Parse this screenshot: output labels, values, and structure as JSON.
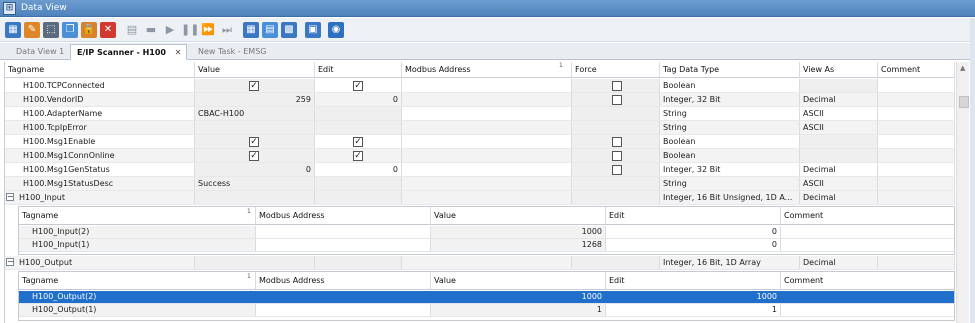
{
  "window": {
    "title": "Data View",
    "app_icon_glyph": "⊞"
  },
  "toolbar": {
    "buttons": [
      {
        "name": "data-view-icon",
        "glyph": "▦",
        "color": "#3b78c4"
      },
      {
        "name": "add-tags-icon",
        "glyph": "✎",
        "color": "#e0862a"
      },
      {
        "name": "select-icon",
        "glyph": "⬚",
        "color": "#5a6b7e"
      },
      {
        "name": "copy-icon",
        "glyph": "❐",
        "color": "#4a8fd8"
      },
      {
        "name": "lock-icon",
        "glyph": "🔒",
        "color": "#d9822b"
      },
      {
        "name": "delete-icon",
        "glyph": "✕",
        "color": "#d23a2f"
      },
      {
        "name": "page-icon",
        "glyph": "▤",
        "color": "grey"
      },
      {
        "name": "save-icon",
        "glyph": "▬",
        "color": "grey"
      },
      {
        "name": "play-icon",
        "glyph": "▶",
        "color": "grey"
      },
      {
        "name": "pause-icon",
        "glyph": "❚❚",
        "color": "grey"
      },
      {
        "name": "step-forward-icon",
        "glyph": "⏩",
        "color": "grey"
      },
      {
        "name": "step-end-icon",
        "glyph": "⏭",
        "color": "grey"
      },
      {
        "name": "grid-view-icon",
        "glyph": "▦",
        "color": "#3b78c4"
      },
      {
        "name": "table-icon",
        "glyph": "▤",
        "color": "#4a8fd8"
      },
      {
        "name": "spreadsheet-icon",
        "glyph": "▩",
        "color": "#3b78c4"
      },
      {
        "name": "properties-icon",
        "glyph": "▣",
        "color": "#3b78c4"
      },
      {
        "name": "help-icon",
        "glyph": "◉",
        "color": "#2d6fc1"
      }
    ]
  },
  "tabs": [
    {
      "label": "Data View 1",
      "active": false
    },
    {
      "label": "E/IP Scanner - H100",
      "active": true,
      "close": "✕"
    },
    {
      "label": "New Task - EMSG",
      "active": false
    }
  ],
  "grid": {
    "columns": [
      "Tagname",
      "Value",
      "Edit",
      "Modbus Address",
      "Force",
      "Tag Data Type",
      "View As",
      "Comment"
    ],
    "sort_indicator": "1",
    "rows": [
      {
        "tagname": "H100.TCPConnected",
        "value": "",
        "value_check": true,
        "edit": "",
        "edit_check": true,
        "force_check": false,
        "type": "Boolean",
        "view_as": ""
      },
      {
        "tagname": "H100.VendorID",
        "value": "259",
        "value_check": null,
        "edit": "0",
        "edit_check": null,
        "force_check": false,
        "type": "Integer, 32 Bit",
        "view_as": "Decimal"
      },
      {
        "tagname": "H100.AdapterName",
        "value": "CBAC-H100",
        "value_check": null,
        "edit": "",
        "edit_check": null,
        "force_check": null,
        "type": "String",
        "view_as": "ASCII"
      },
      {
        "tagname": "H100.TcpIpError",
        "value": "",
        "value_check": null,
        "edit": "",
        "edit_check": null,
        "force_check": null,
        "type": "String",
        "view_as": "ASCII"
      },
      {
        "tagname": "H100.Msg1Enable",
        "value": "",
        "value_check": true,
        "edit": "",
        "edit_check": true,
        "force_check": false,
        "type": "Boolean",
        "view_as": ""
      },
      {
        "tagname": "H100.Msg1ConnOnline",
        "value": "",
        "value_check": true,
        "edit": "",
        "edit_check": true,
        "force_check": false,
        "type": "Boolean",
        "view_as": ""
      },
      {
        "tagname": "H100.Msg1GenStatus",
        "value": "0",
        "value_check": null,
        "edit": "0",
        "edit_check": null,
        "force_check": false,
        "type": "Integer, 32 Bit",
        "view_as": "Decimal"
      },
      {
        "tagname": "H100.Msg1StatusDesc",
        "value": "Success",
        "value_check": null,
        "edit": "",
        "edit_check": null,
        "force_check": null,
        "type": "String",
        "view_as": "ASCII"
      }
    ],
    "input_group": {
      "tagname": "H100_Input",
      "type": "Integer, 16 Bit Unsigned, 1D A...",
      "view_as": "Decimal",
      "sub_columns": [
        "Tagname",
        "Modbus Address",
        "Value",
        "Edit",
        "Comment"
      ],
      "rows": [
        {
          "tagname": "H100_Input(2)",
          "value": "1000",
          "edit": "0"
        },
        {
          "tagname": "H100_Input(1)",
          "value": "1268",
          "edit": "0"
        }
      ]
    },
    "output_group": {
      "tagname": "H100_Output",
      "type": "Integer, 16 Bit, 1D Array",
      "view_as": "Decimal",
      "sub_columns": [
        "Tagname",
        "Modbus Address",
        "Value",
        "Edit",
        "Comment"
      ],
      "rows": [
        {
          "tagname": "H100_Output(2)",
          "value": "1000",
          "edit": "1000",
          "selected": true
        },
        {
          "tagname": "H100_Output(1)",
          "value": "1",
          "edit": "1",
          "selected": false
        }
      ]
    },
    "expander_glyph": "−",
    "check_glyph": "✓"
  },
  "colors": {
    "selection": "#1f6fcb",
    "titlebar": "#4f82bd"
  }
}
